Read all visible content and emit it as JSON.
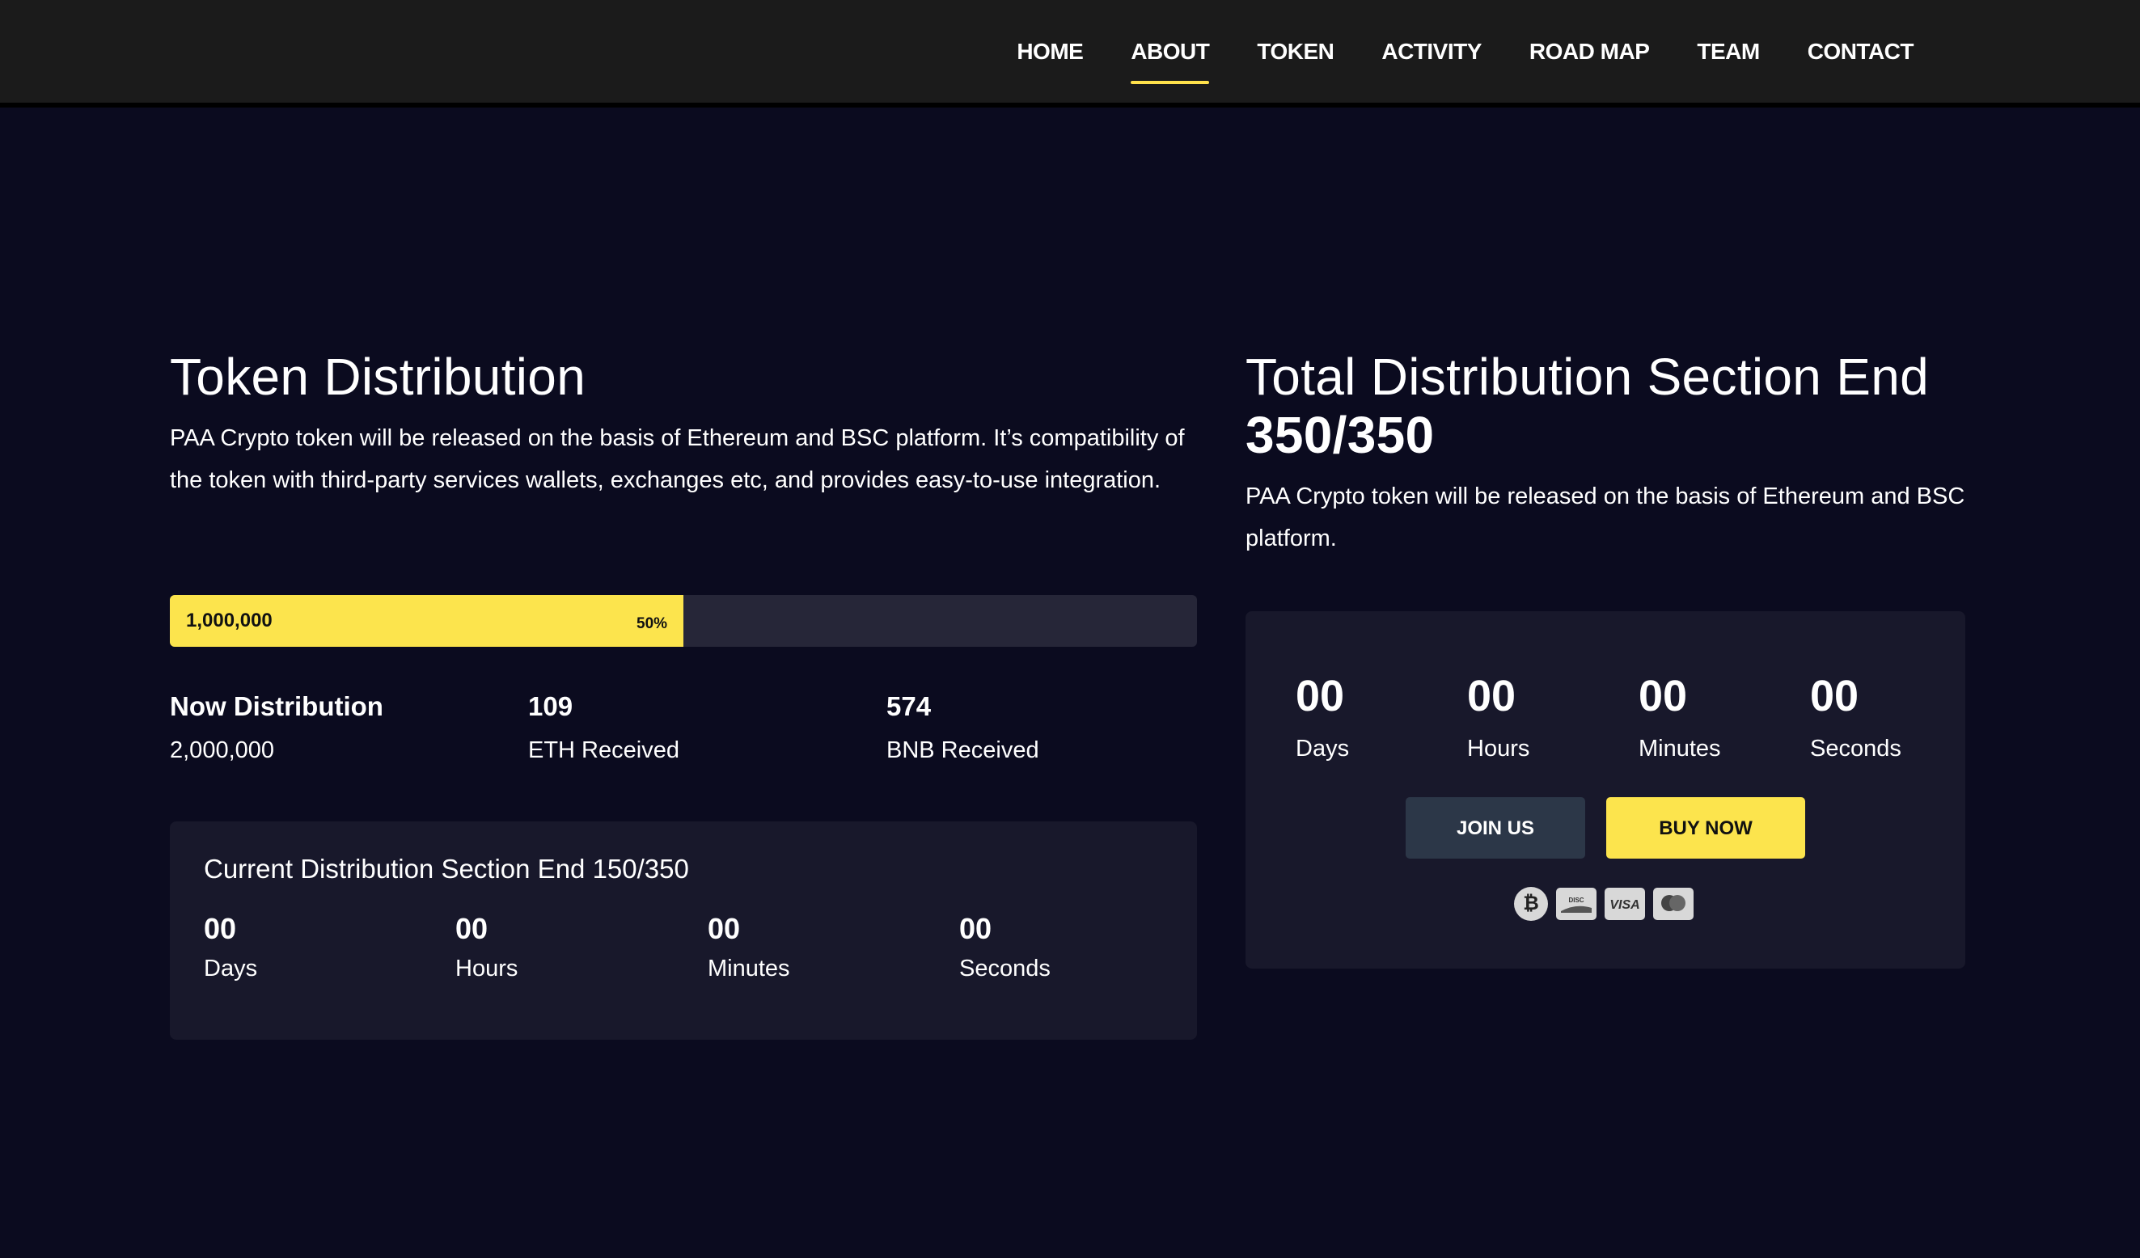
{
  "nav": {
    "items": [
      {
        "label": "HOME"
      },
      {
        "label": "ABOUT",
        "active": true
      },
      {
        "label": "TOKEN"
      },
      {
        "label": "ACTIVITY"
      },
      {
        "label": "ROAD MAP"
      },
      {
        "label": "TEAM"
      },
      {
        "label": "CONTACT"
      }
    ]
  },
  "token_distribution": {
    "title": "Token Distribution",
    "description": "PAA Crypto token will be released on the basis of Ethereum and BSC platform. It’s compatibility of the token with third-party services wallets, exchanges etc, and provides easy-to-use integration.",
    "progress": {
      "amount": "1,000,000",
      "percent_label": "50%",
      "percent": 50
    },
    "stats": [
      {
        "value": "Now Distribution",
        "label": "2,000,000"
      },
      {
        "value": "109",
        "label": "ETH Received"
      },
      {
        "value": "574",
        "label": "BNB Received"
      }
    ],
    "current_section": {
      "title": "Current Distribution Section End 150/350",
      "countdown": [
        {
          "value": "00",
          "label": "Days"
        },
        {
          "value": "00",
          "label": "Hours"
        },
        {
          "value": "00",
          "label": "Minutes"
        },
        {
          "value": "00",
          "label": "Seconds"
        }
      ]
    }
  },
  "total_distribution": {
    "title_prefix": "Total Distribution Section End ",
    "title_value": "350/350",
    "description": "PAA Crypto token will be released on the basis of Ethereum and BSC platform.",
    "countdown": [
      {
        "value": "00",
        "label": "Days"
      },
      {
        "value": "00",
        "label": "Hours"
      },
      {
        "value": "00",
        "label": "Minutes"
      },
      {
        "value": "00",
        "label": "Seconds"
      }
    ],
    "join_label": "JOIN US",
    "buy_label": "BUY NOW",
    "payment_icons": [
      "bitcoin-icon",
      "discover-icon",
      "visa-icon",
      "mastercard-icon"
    ]
  },
  "colors": {
    "accent": "#fce44d",
    "background": "#0b0b1f",
    "card": "#18182b",
    "navbar": "#1b1b1b"
  }
}
